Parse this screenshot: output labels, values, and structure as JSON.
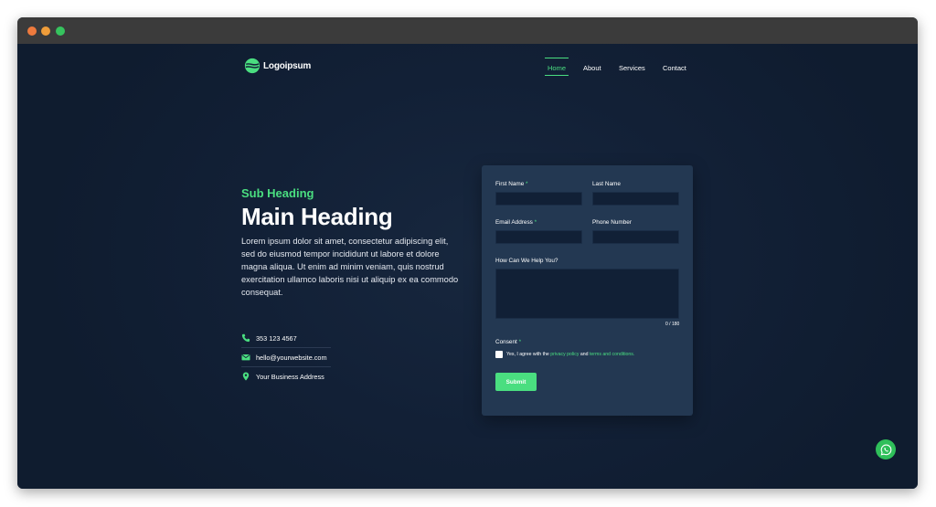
{
  "brand": {
    "name": "Logoipsum",
    "accent": "#4ade80"
  },
  "nav": {
    "items": [
      {
        "label": "Home",
        "active": true
      },
      {
        "label": "About"
      },
      {
        "label": "Services"
      },
      {
        "label": "Contact"
      }
    ]
  },
  "hero": {
    "sub_heading": "Sub Heading",
    "main_heading": "Main Heading",
    "body": "Lorem ipsum dolor sit amet, consectetur adipiscing elit, sed do eiusmod tempor incididunt ut labore et dolore magna aliqua. Ut enim ad minim veniam, quis nostrud exercitation ullamco laboris nisi ut aliquip ex ea commodo consequat."
  },
  "contacts": {
    "phone": {
      "icon": "phone-icon",
      "text": "353 123 4567"
    },
    "email": {
      "icon": "envelope-icon",
      "text": "hello@yourwebsite.com"
    },
    "address": {
      "icon": "map-pin-icon",
      "text": "Your Business Address"
    }
  },
  "form": {
    "first_name_label": "First Name",
    "last_name_label": "Last Name",
    "email_label": "Email Address",
    "phone_label": "Phone Number",
    "help_label": "How Can We Help You?",
    "counter": "0 / 180",
    "consent_label": "Consent",
    "required_mark": "*",
    "agree_prefix": "Yes, I agree with the",
    "privacy_link": "privacy policy",
    "agree_and": "and",
    "terms_link": "terms and conditions.",
    "submit_label": "Submit"
  },
  "whatsapp": {
    "icon": "whatsapp-icon"
  }
}
